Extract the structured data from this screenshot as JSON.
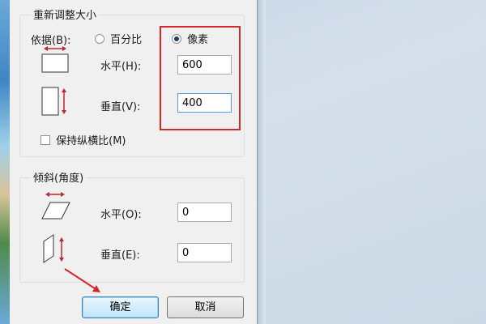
{
  "resize": {
    "group_title": "重新调整大小",
    "by_label": "依据(B):",
    "option_percent": "百分比",
    "option_pixels": "像素",
    "selected": "像素",
    "horizontal_label": "水平(H):",
    "horizontal_value": "600",
    "vertical_label": "垂直(V):",
    "vertical_value": "400",
    "keep_ratio_label": "保持纵横比(M)",
    "keep_ratio_checked": false
  },
  "skew": {
    "group_title": "倾斜(角度)",
    "horizontal_label": "水平(O):",
    "horizontal_value": "0",
    "vertical_label": "垂直(E):",
    "vertical_value": "0"
  },
  "buttons": {
    "ok_label": "确定",
    "cancel_label": "取消"
  },
  "colors": {
    "highlight": "#d62828",
    "arrow": "#d62828"
  }
}
